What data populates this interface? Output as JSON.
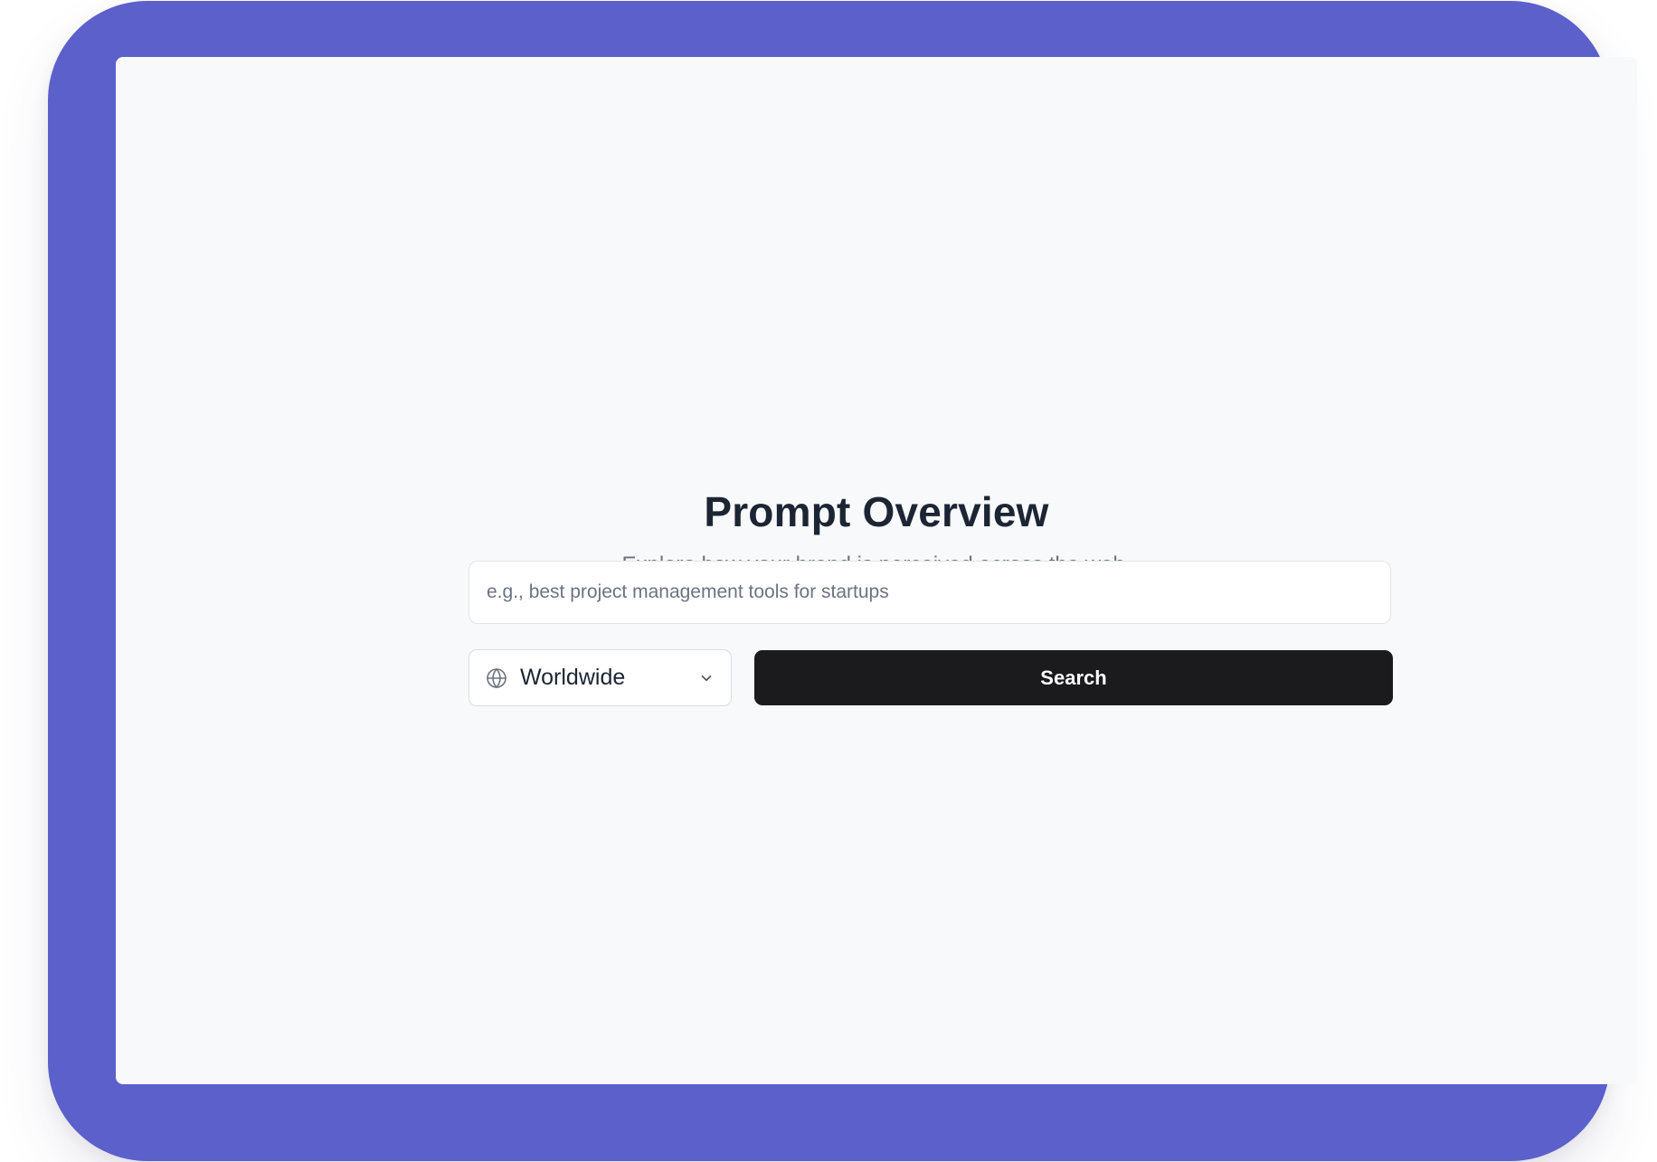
{
  "colors": {
    "frame": "#5c60cb",
    "screen_background": "#f8f9fb",
    "button_background": "#1b1b1d",
    "title_text": "#1c2533",
    "muted_text": "#6b7380"
  },
  "main": {
    "title": "Prompt Overview",
    "subtitle": "Explore how your brand is perceived across the web.",
    "search": {
      "value": "",
      "placeholder": "e.g., best project management tools for startups"
    },
    "region": {
      "icon": "globe-icon",
      "selected": "Worldwide",
      "dropdown_icon": "chevron-down-icon"
    },
    "search_button_label": "Search"
  }
}
